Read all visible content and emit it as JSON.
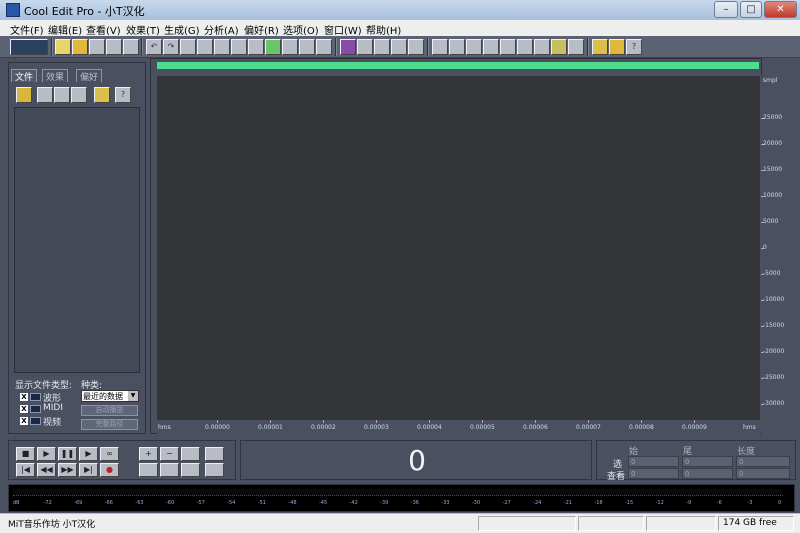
{
  "window": {
    "title": "Cool Edit Pro  - 小T汉化",
    "minimize": "–",
    "maximize": "□",
    "close": "✕"
  },
  "menu": [
    "文件(F)",
    "编辑(E)",
    "查看(V)",
    "效果(T)",
    "生成(G)",
    "分析(A)",
    "偏好(R)",
    "选项(O)",
    "窗口(W)",
    "帮助(H)"
  ],
  "left_panel": {
    "tabs": [
      "文件",
      "效果",
      "偏好"
    ],
    "file_type_label": "显示文件类型:",
    "sort_label": "种类:",
    "file_types": [
      {
        "label": "波形",
        "checked": "X",
        "icon": "wave-icon"
      },
      {
        "label": "MIDI",
        "checked": "X",
        "icon": "midi-icon"
      },
      {
        "label": "视频",
        "checked": "X",
        "icon": "video-icon"
      }
    ],
    "sort_value": "最近的数据",
    "autoplay_button": "自动播放",
    "full_path_button": "完整路径"
  },
  "amplitude_axis": {
    "unit": "smpl",
    "ticks": [
      "25000",
      "20000",
      "15000",
      "10000",
      "5000",
      "0",
      "-5000",
      "-10000",
      "-15000",
      "-20000",
      "-25000",
      "-30000"
    ]
  },
  "time_axis": {
    "unit_left": "hms",
    "unit_right": "hms",
    "ticks": [
      "0.00000",
      "0.00001",
      "0.00002",
      "0.00003",
      "0.00004",
      "0.00005",
      "0.00006",
      "0.00007",
      "0.00008",
      "0.00009"
    ]
  },
  "time_display": "0",
  "selection": {
    "headers": [
      "始",
      "尾",
      "长度"
    ],
    "rows": [
      {
        "label": "选",
        "values": [
          "0",
          "0",
          "0"
        ]
      },
      {
        "label": "查看",
        "values": [
          "0",
          "0",
          "0"
        ]
      }
    ]
  },
  "level_meter": {
    "ticks": [
      "dB",
      "-72",
      "-69",
      "-66",
      "-63",
      "-60",
      "-57",
      "-54",
      "-51",
      "-48",
      "-45",
      "-42",
      "-39",
      "-36",
      "-33",
      "-30",
      "-27",
      "-24",
      "-21",
      "-18",
      "-15",
      "-12",
      "-9",
      "-6",
      "-3",
      "0"
    ]
  },
  "status": {
    "left": "MiT音乐作坊 小T汉化",
    "right": "174 GB free"
  },
  "colors": {
    "overview": "#4edd8f",
    "wave_bg": "#333539",
    "panel_bg": "#4a5060"
  }
}
